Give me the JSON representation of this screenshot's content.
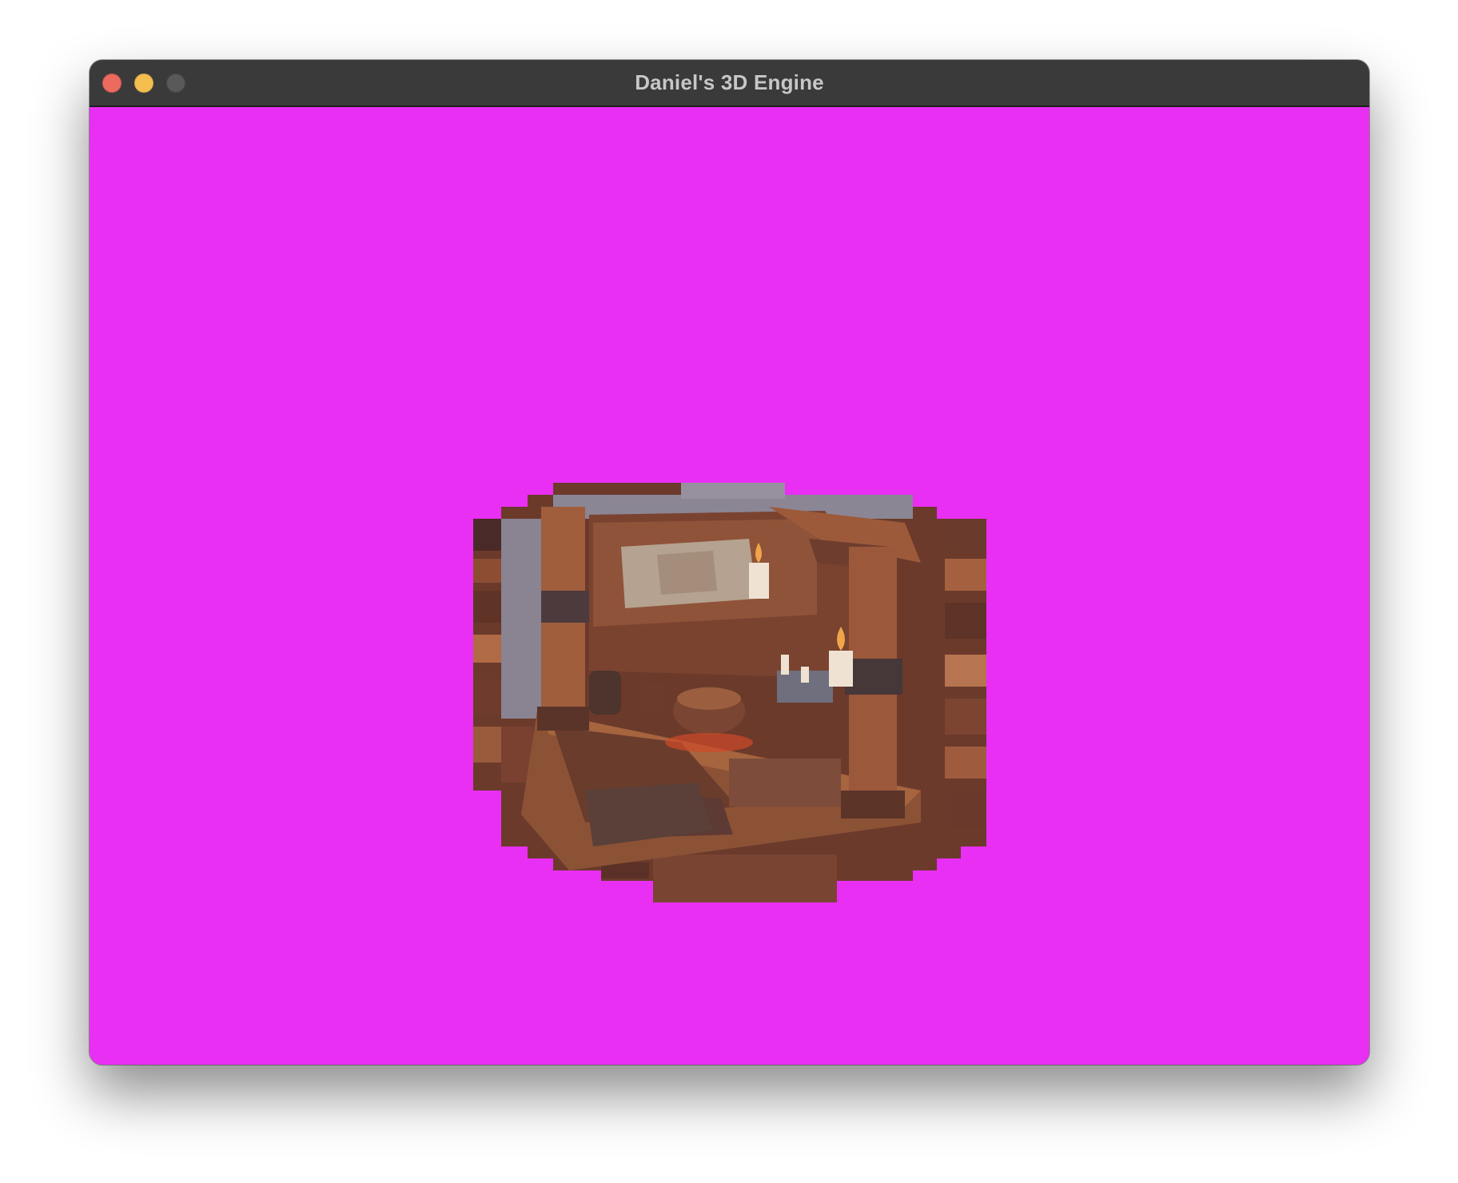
{
  "window": {
    "title": "Daniel's 3D Engine",
    "controls": {
      "close": "close-icon",
      "minimize": "minimize-icon",
      "zoom": "zoom-icon"
    }
  },
  "viewport": {
    "clear_color": "#e92ff3"
  },
  "scene": {
    "description_icon": "rendered-3d-model"
  }
}
